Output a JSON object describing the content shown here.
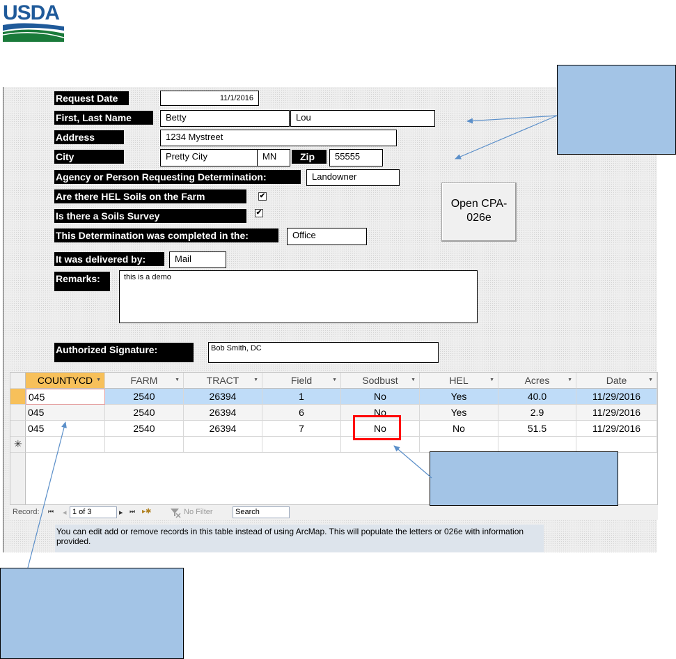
{
  "logo": {
    "text": "USDA",
    "colors": {
      "blue": "#1f5a9a",
      "green": "#1a7a3a"
    }
  },
  "form": {
    "request_date": {
      "label": "Request Date",
      "value": "11/1/2016"
    },
    "name": {
      "label": "First, Last Name",
      "first": "Betty",
      "last": "Lou"
    },
    "address": {
      "label": "Address",
      "value": "1234 Mystreet"
    },
    "city": {
      "label": "City",
      "value": "Pretty City",
      "state": "MN",
      "zip_label": "Zip",
      "zip": "55555"
    },
    "agency": {
      "label": "Agency or Person Requesting Determination:",
      "value": "Landowner"
    },
    "hel_soils": {
      "label": "Are there HEL Soils on the Farm",
      "checked": true,
      "mark": "✔"
    },
    "soils_survey": {
      "label": "Is there a Soils Survey",
      "checked": true,
      "mark": "✔"
    },
    "completed_in": {
      "label": "This Determination was completed in the:",
      "value": "Office"
    },
    "delivered_by": {
      "label": "It was delivered by:",
      "value": "Mail"
    },
    "remarks": {
      "label": "Remarks:",
      "value": "this is a demo"
    },
    "signature": {
      "label": "Authorized Signature:",
      "value": "Bob Smith, DC"
    },
    "open_button": "Open CPA-026e"
  },
  "table": {
    "columns": [
      "COUNTYCD",
      "FARM",
      "TRACT",
      "Field",
      "Sodbust",
      "HEL",
      "Acres",
      "Date"
    ],
    "sort_icon": "▼",
    "rows": [
      [
        "045",
        "2540",
        "26394",
        "1",
        "No",
        "Yes",
        "40.0",
        "11/29/2016"
      ],
      [
        "045",
        "2540",
        "26394",
        "6",
        "No",
        "Yes",
        "2.9",
        "11/29/2016"
      ],
      [
        "045",
        "2540",
        "26394",
        "7",
        "No",
        "No",
        "51.5",
        "11/29/2016"
      ]
    ],
    "new_row_marker": "✳"
  },
  "nav": {
    "record_label": "Record:",
    "first": "⏮",
    "prev": "◂",
    "position": "1 of 3",
    "next": "▸",
    "last": "⏭",
    "new": "▸✱",
    "filter": "No Filter",
    "search": "Search"
  },
  "note": "You can edit add or remove records in this table instead of using ArcMap. This will populate the letters or 026e with information provided.",
  "colors": {
    "callout": "#a3c4e6",
    "selected": "#bfdcf8",
    "header_active": "#f7c05a",
    "highlight": "#ff0000",
    "arrow": "#5b8fc9"
  }
}
